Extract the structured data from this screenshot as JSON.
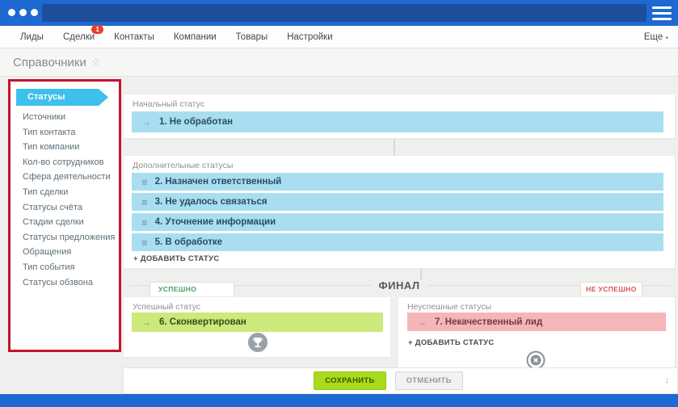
{
  "nav": {
    "items": [
      {
        "label": "Лиды"
      },
      {
        "label": "Сделки",
        "badge": "1"
      },
      {
        "label": "Контакты"
      },
      {
        "label": "Компании"
      },
      {
        "label": "Товары"
      },
      {
        "label": "Настройки"
      }
    ],
    "more": "Еще"
  },
  "page": {
    "title": "Справочники",
    "star": "☆"
  },
  "sidebar": {
    "selected": "Статусы",
    "items": [
      "Источники",
      "Тип контакта",
      "Тип компании",
      "Кол-во сотрудников",
      "Сфера деятельности",
      "Тип сделки",
      "Статусы счёта",
      "Стадии сделки",
      "Статусы предложения",
      "Обращения",
      "Тип события",
      "Статусы обзвона"
    ]
  },
  "pipeline": {
    "initial": {
      "label": "Начальный статус",
      "arrow": "→",
      "status": "1. Не обработан"
    },
    "additional": {
      "label": "Дополнительные статусы",
      "handle": "≡",
      "statuses": [
        "2. Назначен ответственный",
        "3. Не удалось связаться",
        "4. Уточнение информации",
        "5. В обработке"
      ],
      "add": "+ ДОБАВИТЬ СТАТУС"
    },
    "final": {
      "title": "ФИНАЛ",
      "tabs": {
        "success": "УСПЕШНО",
        "fail": "НЕ УСПЕШНО"
      },
      "success": {
        "label": "Успешный статус",
        "arrow": "→",
        "status": "6. Сконвертирован"
      },
      "fail": {
        "label": "Неуспешные статусы",
        "arrow": "→",
        "status": "7. Некачественный лид",
        "add": "+ ДОБАВИТЬ СТАТУС"
      }
    },
    "actions": {
      "save": "СОХРАНИТЬ",
      "cancel": "ОТМЕНИТЬ",
      "scroll_hint": "↓"
    }
  },
  "misc": {
    "more_chevron": "▾"
  },
  "colors": {
    "accent_blue": "#1e69d2",
    "addressbar_blue": "#1d4f9b",
    "selected_cyan": "#3fc0ec",
    "status_blue": "#a9def1",
    "status_green": "#cde87b",
    "status_pink": "#f6b5b9",
    "save_green": "#a8db1e",
    "badge_red": "#e8402a",
    "annotation_red": "#c1142c"
  }
}
